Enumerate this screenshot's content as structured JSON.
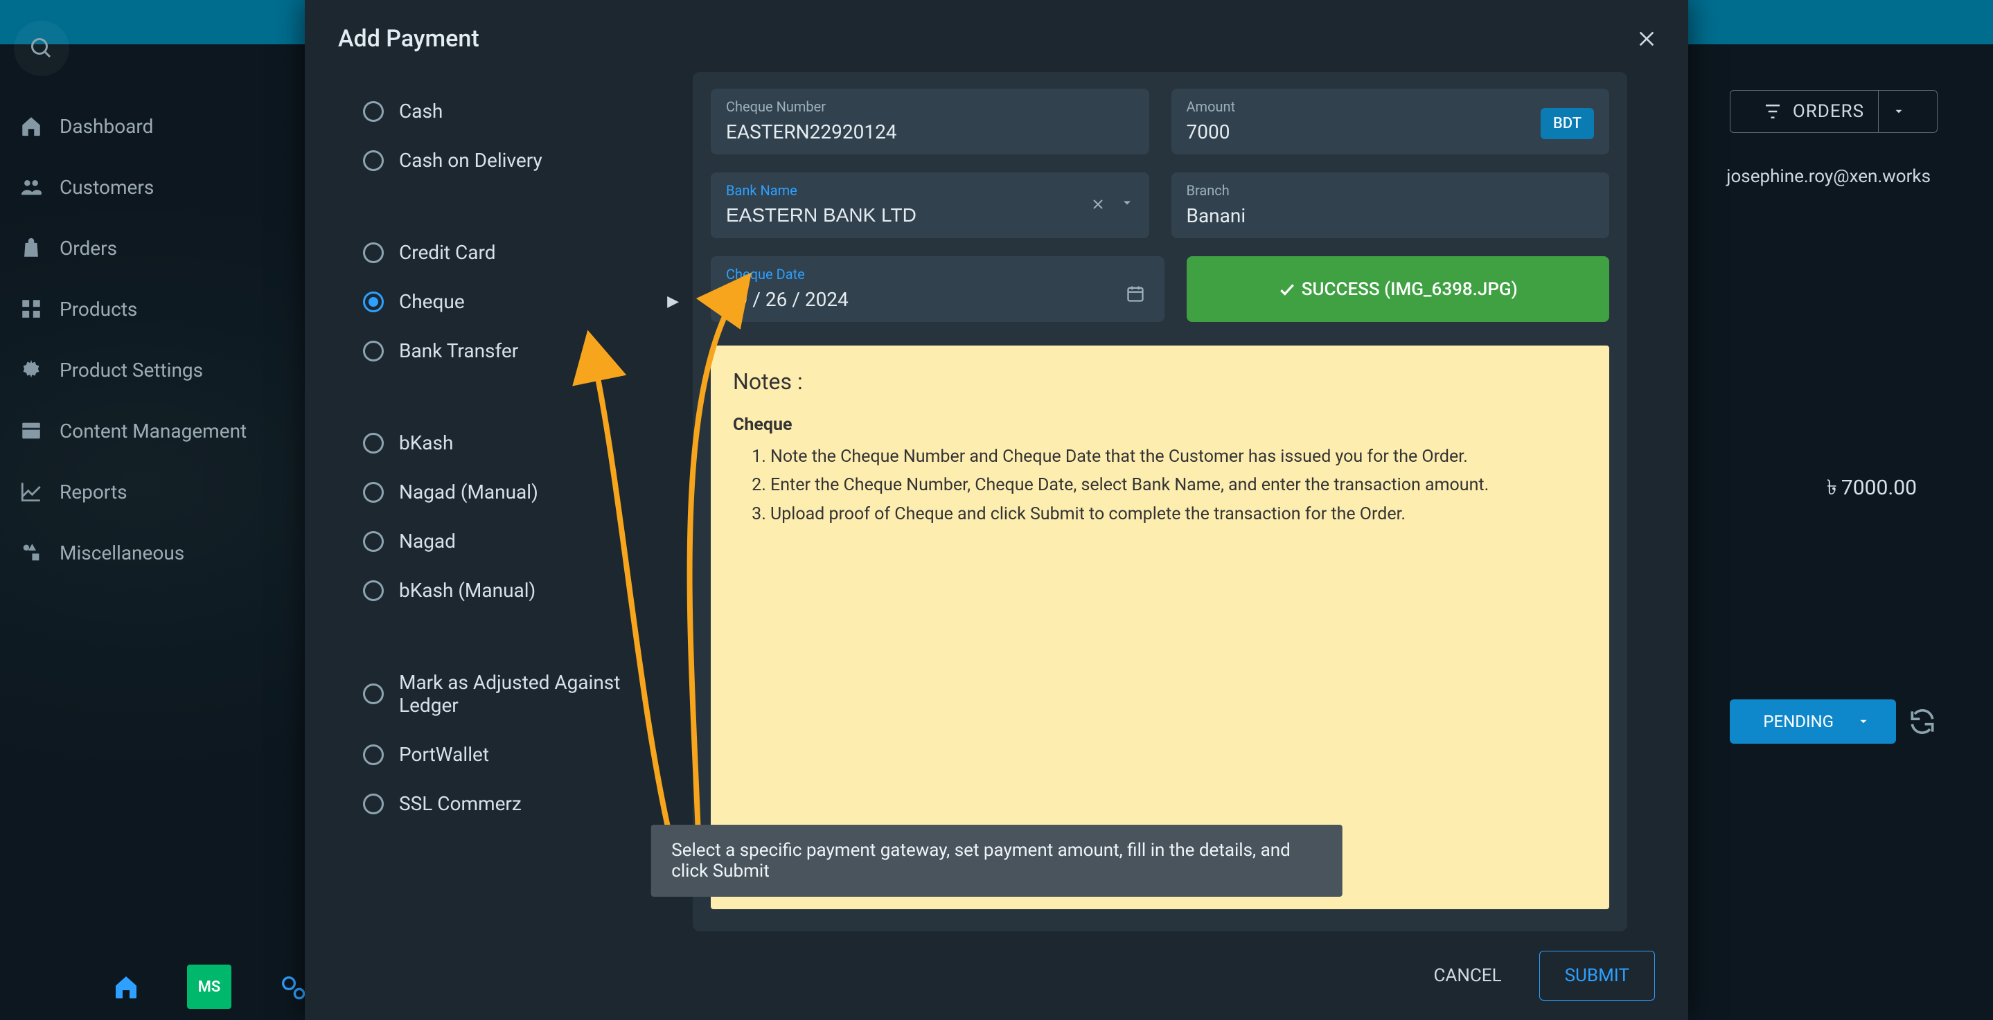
{
  "modal": {
    "title": "Add Payment",
    "cancel": "CANCEL",
    "submit": "SUBMIT",
    "tooltip": "Select a specific payment gateway, set payment amount, fill in the details, and click Submit"
  },
  "methods": {
    "group1": [
      {
        "id": "cash",
        "label": "Cash"
      },
      {
        "id": "cod",
        "label": "Cash on Delivery"
      }
    ],
    "group2": [
      {
        "id": "credit",
        "label": "Credit Card"
      },
      {
        "id": "cheque",
        "label": "Cheque",
        "selected": true
      },
      {
        "id": "bank",
        "label": "Bank Transfer"
      }
    ],
    "group3": [
      {
        "id": "bkash",
        "label": "bKash"
      },
      {
        "id": "nagadm",
        "label": "Nagad (Manual)"
      },
      {
        "id": "nagad",
        "label": "Nagad"
      },
      {
        "id": "bkashm",
        "label": "bKash (Manual)"
      }
    ],
    "group4": [
      {
        "id": "ledger",
        "label": "Mark as Adjusted Against Ledger"
      },
      {
        "id": "portwallet",
        "label": "PortWallet"
      },
      {
        "id": "ssl",
        "label": "SSL Commerz"
      }
    ]
  },
  "form": {
    "cheque_number_label": "Cheque Number",
    "cheque_number_value": "EASTERN22920124",
    "amount_label": "Amount",
    "amount_value": "7000",
    "currency": "BDT",
    "bank_label": "Bank Name",
    "bank_value": "EASTERN BANK LTD",
    "branch_label": "Branch",
    "branch_value": "Banani",
    "date_label": "Cheque Date",
    "date_value": "09 / 26 / 2024",
    "upload_success": "SUCCESS (IMG_6398.JPG)"
  },
  "notes": {
    "heading": "Notes :",
    "title": "Cheque",
    "steps": [
      "Note the Cheque Number and Cheque Date that the Customer has issued you for the Order.",
      "Enter the Cheque Number, Cheque Date, select Bank Name, and enter the transaction amount.",
      "Upload proof of Cheque and click Submit to complete the transaction for the Order."
    ]
  },
  "sidebar": {
    "items": [
      "Dashboard",
      "Customers",
      "Orders",
      "Products",
      "Product Settings",
      "Content Management",
      "Reports",
      "Miscellaneous"
    ]
  },
  "bg": {
    "orders_filter": "ORDERS",
    "email": "josephine.roy@xen.works",
    "amount": "7000.00",
    "currency_symbol": "৳",
    "pending": "PENDING",
    "ms": "MS"
  }
}
